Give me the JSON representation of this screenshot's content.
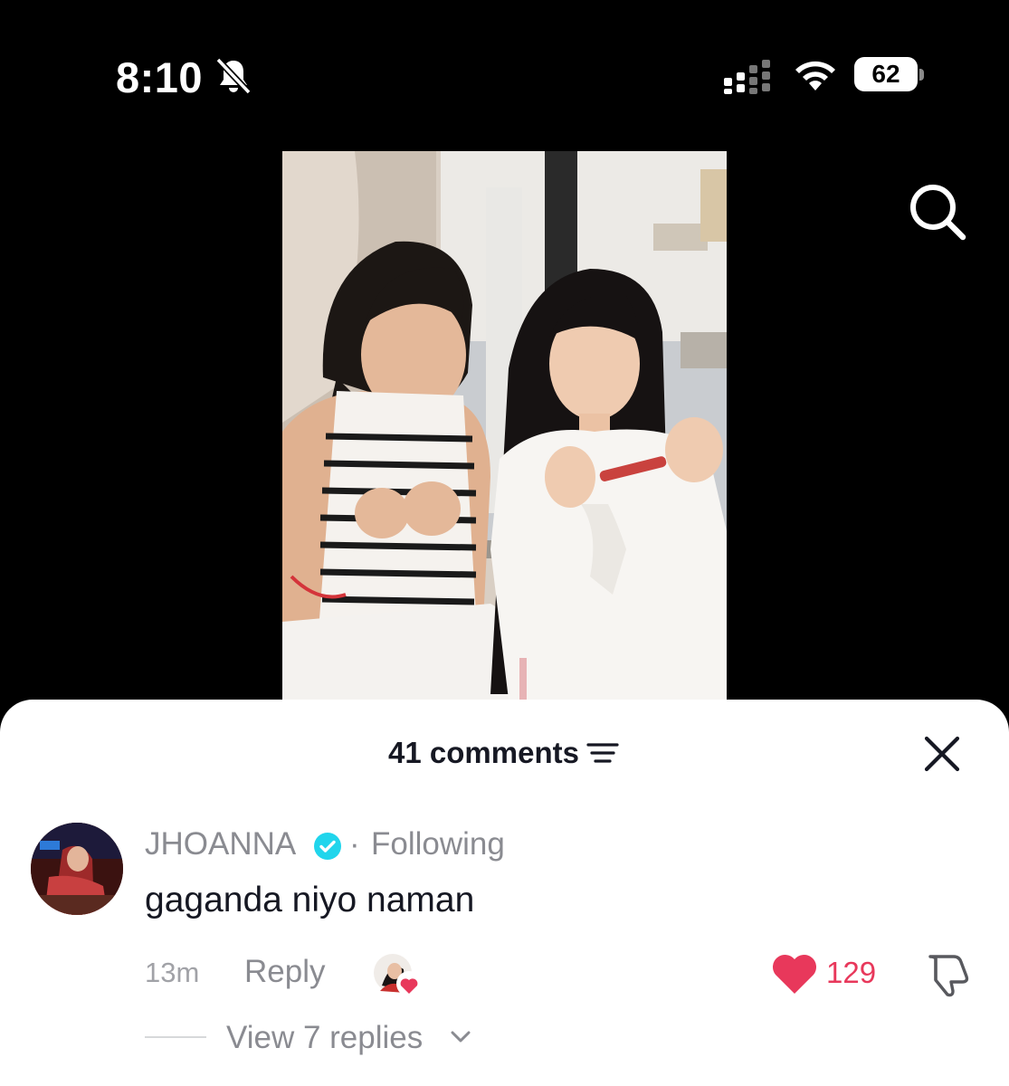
{
  "status_bar": {
    "time": "8:10",
    "battery": "62",
    "icons": [
      "bell-off-icon",
      "signal-icon",
      "wifi-icon",
      "battery-icon"
    ]
  },
  "header": {
    "search_icon": "search-icon"
  },
  "comments": {
    "count_label": "41 comments",
    "sort_icon": "sort-lines-icon",
    "close_icon": "close-icon",
    "items": [
      {
        "username": "JHOANNA",
        "verified": true,
        "separator": "·",
        "relation": "Following",
        "text": "gaganda niyo naman",
        "time": "13m",
        "reply_label": "Reply",
        "like_count": "129",
        "view_replies_label": "View 7 replies"
      }
    ]
  },
  "colors": {
    "like_red": "#e8385b",
    "verified_blue": "#20d5ec",
    "muted_text": "#8a8b91"
  }
}
